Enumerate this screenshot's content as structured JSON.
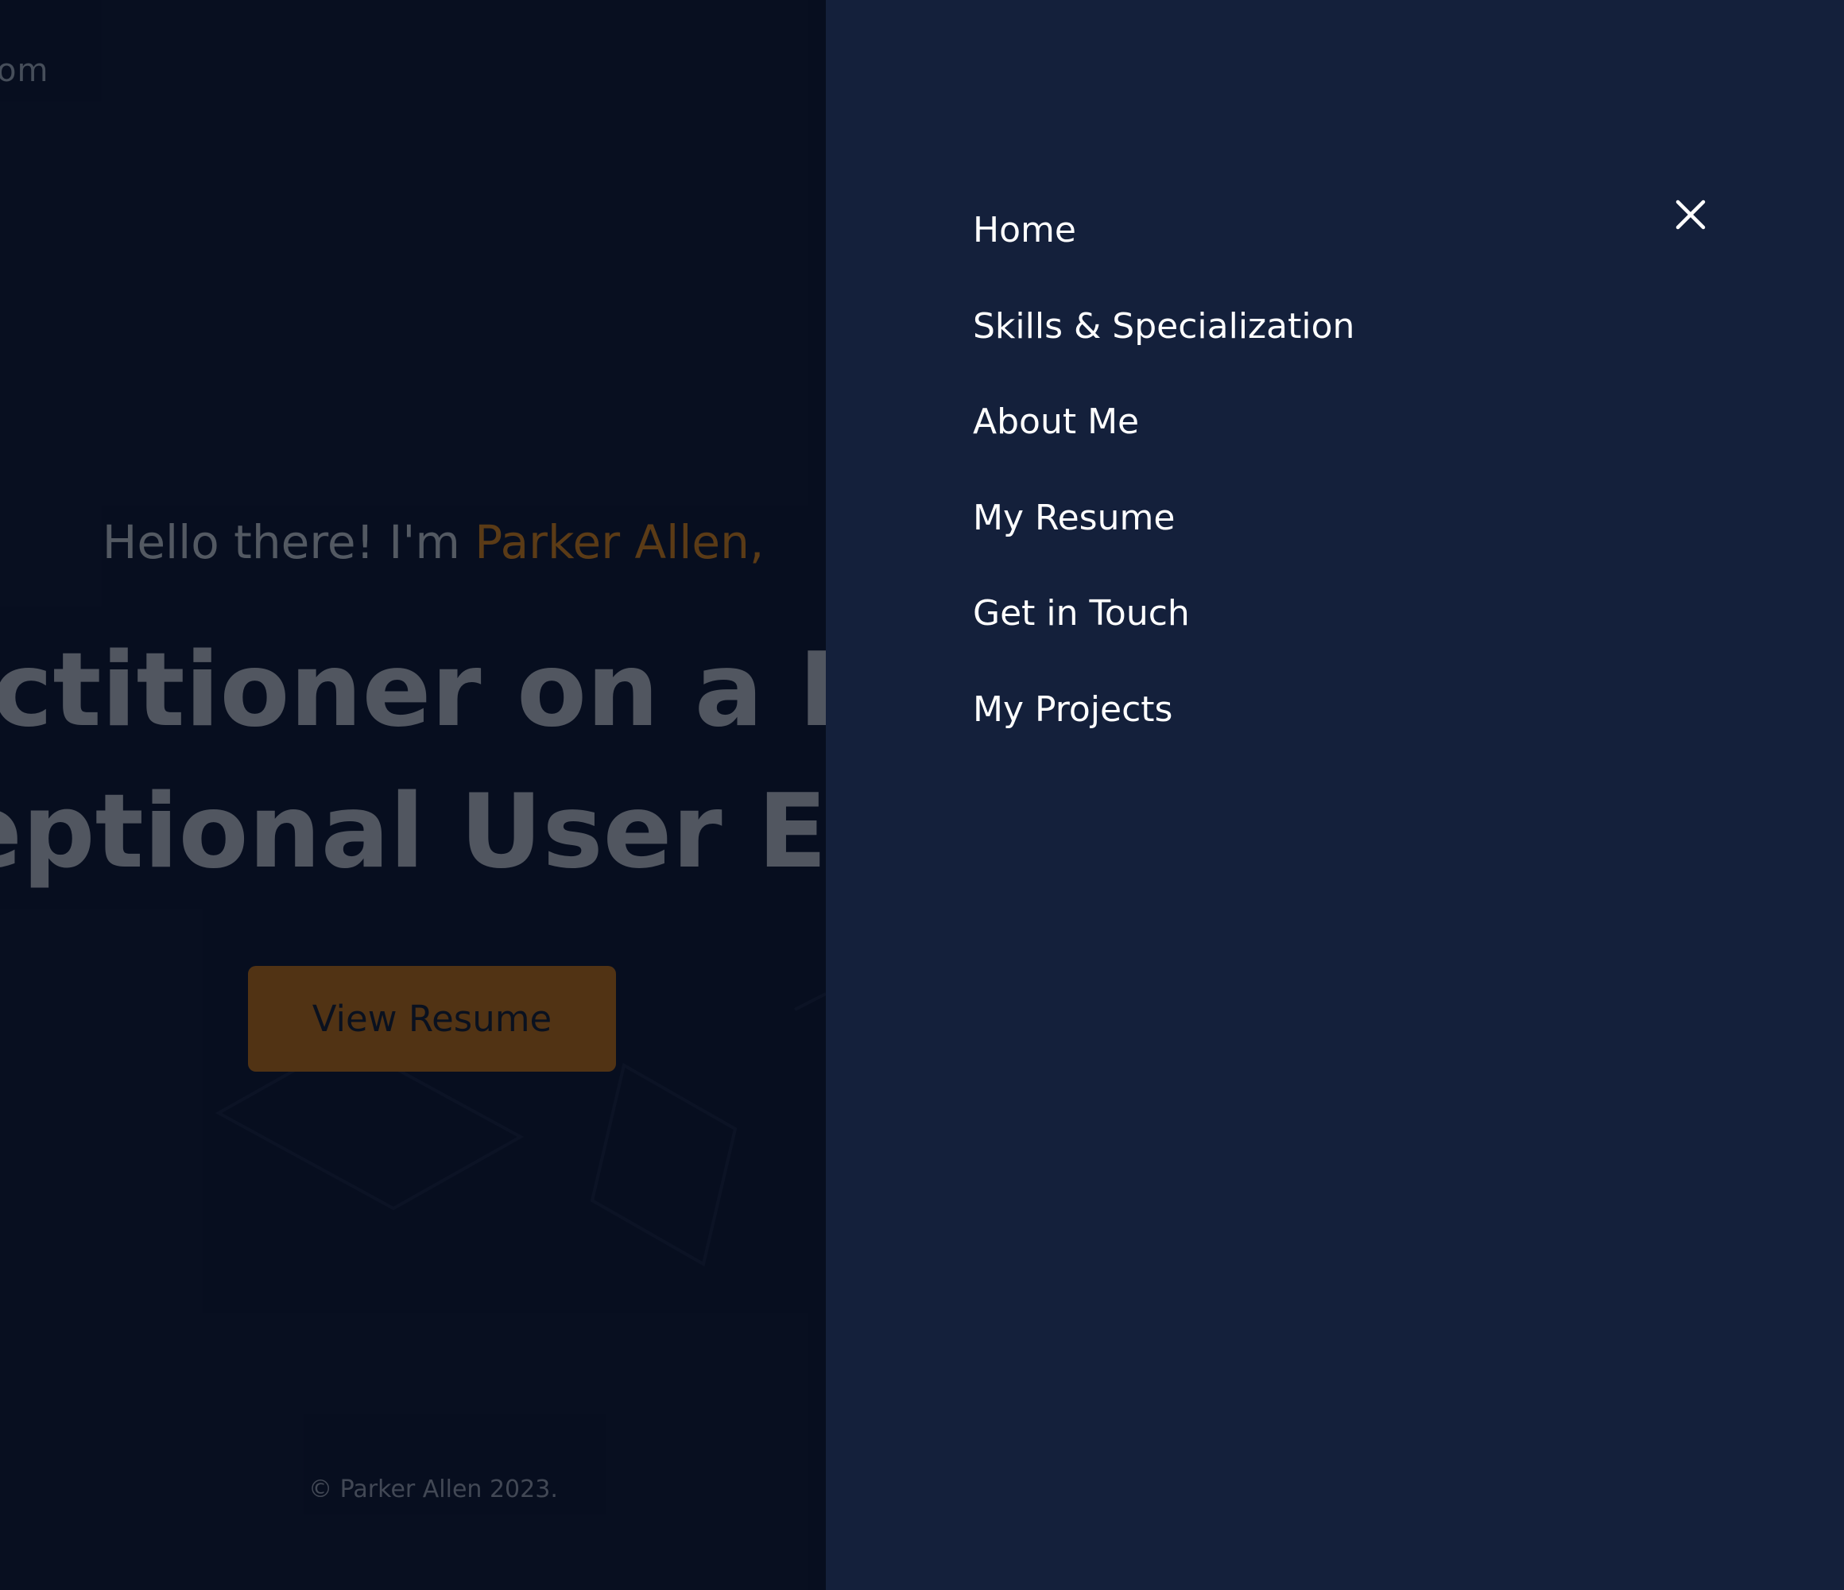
{
  "page": {
    "logo_fragment": "om",
    "greeting_prefix": "Hello there! I'm ",
    "greeting_name": "Parker Allen,",
    "headline_line1": "actitioner on a Mi",
    "headline_line2": "ceptional User Exp",
    "cta_label": "View Resume",
    "copyright": "© Parker Allen 2023."
  },
  "menu": {
    "items": [
      {
        "label": "Home"
      },
      {
        "label": "Skills & Specialization"
      },
      {
        "label": "About Me"
      },
      {
        "label": "My Resume"
      },
      {
        "label": "Get in Touch"
      },
      {
        "label": "My Projects"
      }
    ],
    "close_icon": "close-icon"
  },
  "colors": {
    "page_background": "#0a1226",
    "menu_background": "#14203b",
    "accent": "#8b5617",
    "button_background": "#7b4a15",
    "menu_text": "#ffffff"
  }
}
